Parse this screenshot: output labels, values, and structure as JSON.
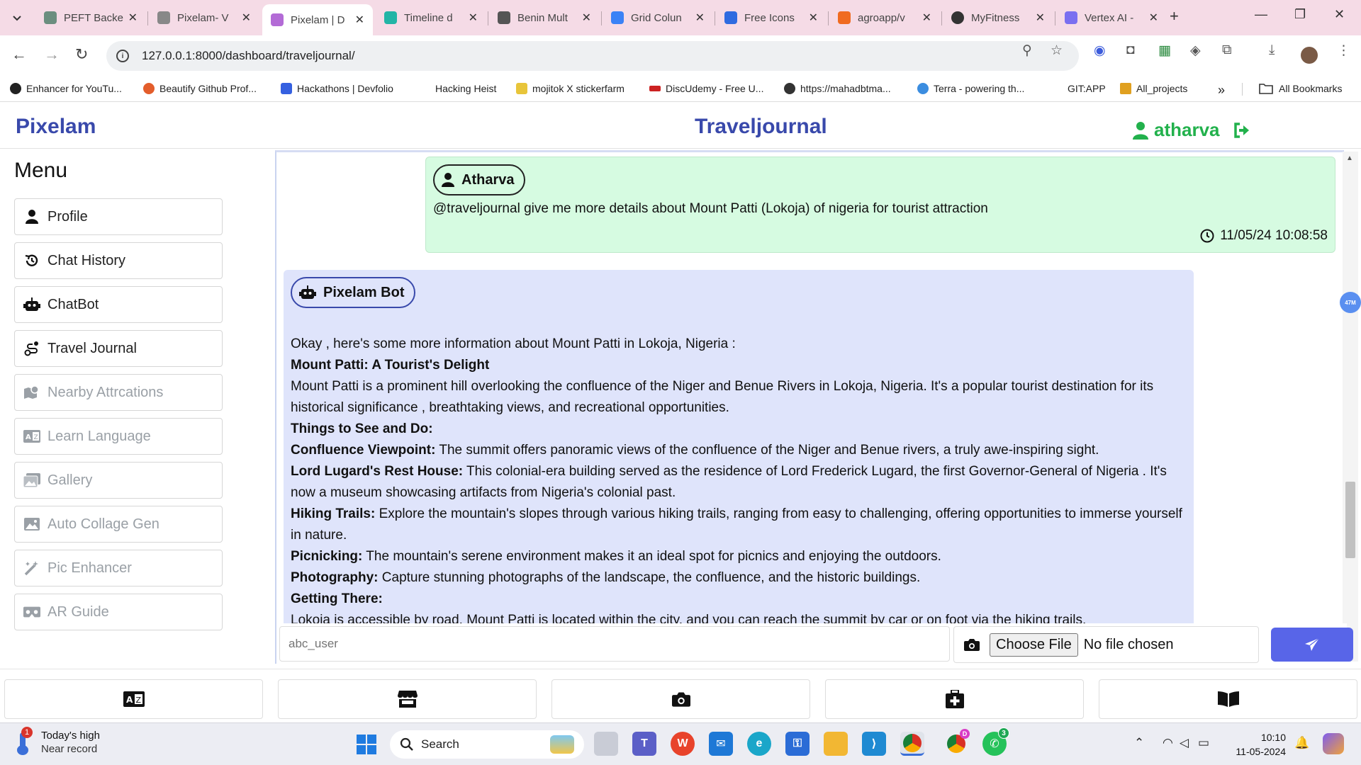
{
  "browser": {
    "tabs": [
      {
        "label": "PEFT Backe",
        "color": "#6b8e7f"
      },
      {
        "label": "Pixelam- V",
        "color": "#888888"
      },
      {
        "label": "Pixelam | D",
        "color": "#b36bd6",
        "active": true
      },
      {
        "label": "Timeline d",
        "color": "#22b5a6"
      },
      {
        "label": "Benin Mult",
        "color": "#555555"
      },
      {
        "label": "Grid Colun",
        "color": "#3b82f6"
      },
      {
        "label": "Free Icons",
        "color": "#2f6be0"
      },
      {
        "label": "agroapp/v",
        "color": "#f06b20"
      },
      {
        "label": "MyFitness",
        "color": "#333333"
      },
      {
        "label": "Vertex AI -",
        "color": "#7a6ff0"
      }
    ],
    "url": "127.0.0.1:8000/dashboard/traveljournal/",
    "bookmarks": [
      {
        "label": "Enhancer for YouTu...",
        "color": "#222222"
      },
      {
        "label": "Beautify Github Prof...",
        "color": "#e35d2b"
      },
      {
        "label": "Hackathons | Devfolio",
        "color": "#3560e0"
      },
      {
        "label": "Hacking Heist",
        "color": ""
      },
      {
        "label": "mojitok X stickerfarm",
        "color": "#e8c53a"
      },
      {
        "label": "DiscUdemy - Free U...",
        "color": "#cc2222"
      },
      {
        "label": "https://mahadbtma...",
        "color": "#333333"
      },
      {
        "label": "Terra - powering th...",
        "color": "#3b8de0"
      },
      {
        "label": "GIT:APP",
        "color": ""
      },
      {
        "label": "All_projects",
        "color": "#e0a020"
      }
    ],
    "all_bookmarks": "All Bookmarks"
  },
  "app": {
    "brand": "Pixelam",
    "title": "Traveljournal",
    "username": "atharva",
    "accent": "#3949ab",
    "user_color": "#22b14c"
  },
  "sidebar": {
    "title": "Menu",
    "items": [
      {
        "label": "Profile",
        "icon": "user-icon",
        "enabled": true
      },
      {
        "label": "Chat History",
        "icon": "history-icon",
        "enabled": true
      },
      {
        "label": "ChatBot",
        "icon": "robot-icon",
        "enabled": true
      },
      {
        "label": "Travel Journal",
        "icon": "route-icon",
        "enabled": true
      },
      {
        "label": "Nearby Attrcations",
        "icon": "map-icon",
        "enabled": false
      },
      {
        "label": "Learn Language",
        "icon": "language-icon",
        "enabled": false
      },
      {
        "label": "Gallery",
        "icon": "images-icon",
        "enabled": false
      },
      {
        "label": "Auto Collage Gen",
        "icon": "image-icon",
        "enabled": false
      },
      {
        "label": "Pic Enhancer",
        "icon": "magic-wand-icon",
        "enabled": false
      },
      {
        "label": "AR Guide",
        "icon": "vr-cardboard-icon",
        "enabled": false
      }
    ]
  },
  "chat": {
    "user_message": {
      "sender": "Atharva",
      "text": "@traveljournal give me more details about Mount Patti (Lokoja) of nigeria for tourist attraction",
      "time": "11/05/24 10:08:58",
      "bg": "#d6fbe1"
    },
    "bot_message": {
      "sender": "Pixelam Bot",
      "bg": "#dfe4fb",
      "intro": "Okay , here's some more information about Mount Patti in Lokoja, Nigeria :",
      "heading1": "Mount Patti: A Tourist's Delight",
      "para1": "Mount Patti is a prominent hill overlooking the confluence of the Niger and Benue Rivers in Lokoja, Nigeria. It's a popular tourist destination for its historical significance , breathtaking views, and recreational opportunities.",
      "heading2": "Things to See and Do:",
      "items": [
        {
          "title": "Confluence Viewpoint:",
          "text": " The summit offers panoramic views of the confluence of the Niger and Benue rivers, a truly awe-inspiring sight."
        },
        {
          "title": "Lord Lugard's Rest House:",
          "text": " This colonial-era building served as the residence of Lord Frederick Lugard, the first Governor-General of Nigeria . It's now a museum showcasing artifacts from Nigeria's colonial past."
        },
        {
          "title": "Hiking Trails:",
          "text": " Explore the mountain's slopes through various hiking trails, ranging from easy to challenging, offering opportunities to immerse yourself in nature."
        },
        {
          "title": "Picnicking:",
          "text": " The mountain's serene environment makes it an ideal spot for picnics and enjoying the outdoors."
        },
        {
          "title": "Photography:",
          "text": " Capture stunning photographs of the landscape, the confluence, and the historic buildings."
        }
      ],
      "heading3": "Getting There:",
      "para2": "Lokoja is accessible by road. Mount Patti is located within the city, and you can reach the summit by car or on foot via the hiking trails."
    }
  },
  "composer": {
    "placeholder": "abc_user",
    "choose_file": "Choose File",
    "no_file": "No file chosen",
    "send_color": "#5865e8"
  },
  "bottom_nav": [
    {
      "icon": "language-icon"
    },
    {
      "icon": "store-icon"
    },
    {
      "icon": "camera-icon"
    },
    {
      "icon": "first-aid-kit-icon"
    },
    {
      "icon": "book-open-icon"
    }
  ],
  "taskbar": {
    "weather_title": "Today's high",
    "weather_sub": "Near record",
    "weather_badge": "1",
    "search": "Search",
    "time": "10:10",
    "date": "11-05-2024",
    "whatsapp_badge": "3",
    "chrome_badge": "D"
  },
  "extension_badge": "47M"
}
